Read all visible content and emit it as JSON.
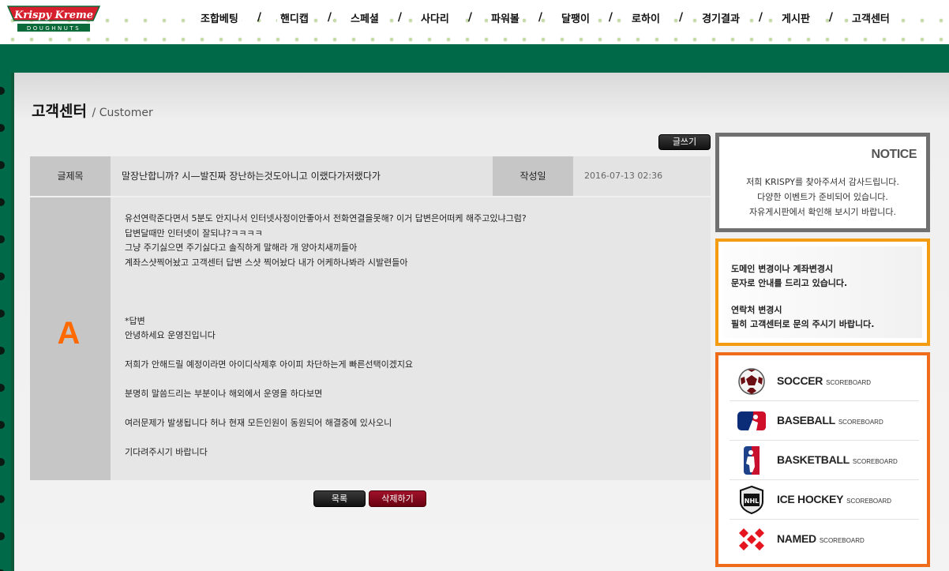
{
  "header": {
    "logo_text": "Krispy Kreme",
    "logo_sub": "DOUGHNUTS",
    "nav": [
      "조합베팅",
      "핸디캡",
      "스페셜",
      "사다리",
      "파워볼",
      "달팽이",
      "로하이",
      "경기결과",
      "게시판",
      "고객센터"
    ],
    "nav_separator": "/"
  },
  "page": {
    "title": "고객센터",
    "subtitle": "/ Customer",
    "write_button": "글쓰기"
  },
  "post": {
    "subject_label": "글제목",
    "subject": "말장난합니까? 시—발진짜 장난하는것도아니고 이랬다가저랬다가",
    "date_label": "작성일",
    "date": "2016-07-13 02:36",
    "answer_mark": "A",
    "content_lines": [
      "유선연락준다면서 5분도 안지나서 인터넷사정이안좋아서 전화연결을못해? 이거 답변은어떠케 해주고있냐그럼?",
      "답변달때만 인터넷이 잘되냐?ㅋㅋㅋㅋ",
      "그냥 주기싫으면 주기싫다고 솔직하게 말해라 개 양아치새끼들아",
      "계좌스샷찍어놨고 고객센터 답변 스샷 찍어놨다 내가 어케하나봐라 시발련들아",
      "",
      "",
      "",
      "*답변",
      "안녕하세요 운영진입니다",
      "",
      "저희가 안해드릴 예정이라면 아이디삭제후 아이피 차단하는게 빠른선택이겠지요",
      "",
      "분명히 말씀드리는 부분이나 해외에서 운영을 하다보면",
      "",
      "여러문제가 발생됩니다 허나 현재 모든인원이 동원되어 해결중에 있사오니",
      "",
      "기다려주시기 바랍니다"
    ],
    "list_button": "목록",
    "delete_button": "삭제하기"
  },
  "sidebar": {
    "notice_title": "NOTICE",
    "notice_lines": [
      "저희 KRISPY를 찾아주셔서 감사드립니다.",
      "다양한 이벤트가 준비되어 있습니다.",
      "자유게시판에서 확인해 보시기 바랍니다."
    ],
    "info_lines": [
      "도메인 변경이나 계좌변경시",
      "문자로 안내를 드리고 있습니다.",
      "",
      "연락처 변경시",
      "필히 고객센터로 문의 주시기 바랍니다."
    ],
    "scoreboard_suffix": "SCOREBOARD",
    "scoreboards": [
      {
        "name": "SOCCER",
        "icon": "soccer-ball-icon"
      },
      {
        "name": "BASEBALL",
        "icon": "mlb-logo-icon"
      },
      {
        "name": "BASKETBALL",
        "icon": "nba-logo-icon"
      },
      {
        "name": "ICE HOCKEY",
        "icon": "nhl-logo-icon"
      },
      {
        "name": "NAMED",
        "icon": "named-logo-icon"
      }
    ]
  },
  "colors": {
    "brand_green": "#006a48",
    "accent_orange": "#ff6a00",
    "delete_red": "#8a0a1e"
  }
}
